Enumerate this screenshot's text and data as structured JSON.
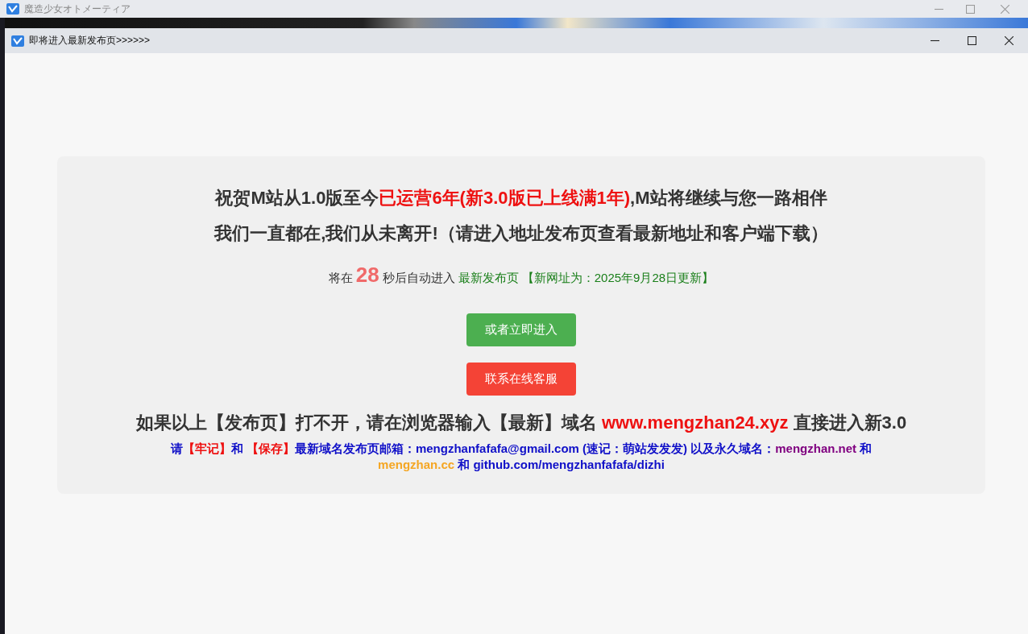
{
  "outer_window": {
    "title": "魔造少女オトメーティア"
  },
  "dialog": {
    "title": "即将进入最新发布页>>>>>>"
  },
  "headline": [
    {
      "kind": "plain",
      "text": "祝贺M站从1.0版至今"
    },
    {
      "kind": "red",
      "text": "已运营6年(新3.0版已上线满1年)"
    },
    {
      "kind": "plain",
      "text": ",M站将继续与您一路相伴"
    }
  ],
  "subheadline": "我们一直都在,我们从未离开!（请进入地址发布页查看最新地址和客户端下载）",
  "countdown": {
    "before": "将在",
    "seconds": "28",
    "after": "秒后自动进入",
    "link": "最新发布页",
    "note": "【新网址为：2025年9月28日更新】"
  },
  "buttons": [
    {
      "label": "或者立即进入",
      "kind": "primary"
    },
    {
      "label": "联系在线客服",
      "kind": "danger"
    }
  ],
  "fallback": [
    {
      "kind": "plain",
      "text": "如果以上【发布页】打不开，请在浏览器输入【最新】域名 "
    },
    {
      "kind": "red",
      "text": "www.mengzhan24.xyz"
    },
    {
      "kind": "plain",
      "text": " 直接进入新3.0"
    }
  ],
  "notice": [
    {
      "kind": "blue",
      "text": "请"
    },
    {
      "kind": "red",
      "text": "【牢记】"
    },
    {
      "kind": "blue",
      "text": "和 "
    },
    {
      "kind": "red",
      "text": "【保存】"
    },
    {
      "kind": "blue",
      "text": "最新域名发布页邮箱：mengzhanfafafa@gmail.com (速记：萌站发发发) 以及永久域名："
    },
    {
      "kind": "purple",
      "text": "mengzhan.net"
    },
    {
      "kind": "blue",
      "text": " 和 "
    },
    {
      "kind": "orange",
      "text": "mengzhan.cc"
    },
    {
      "kind": "blue",
      "text": " 和 github.com/mengzhanfafafa/dizhi"
    }
  ]
}
